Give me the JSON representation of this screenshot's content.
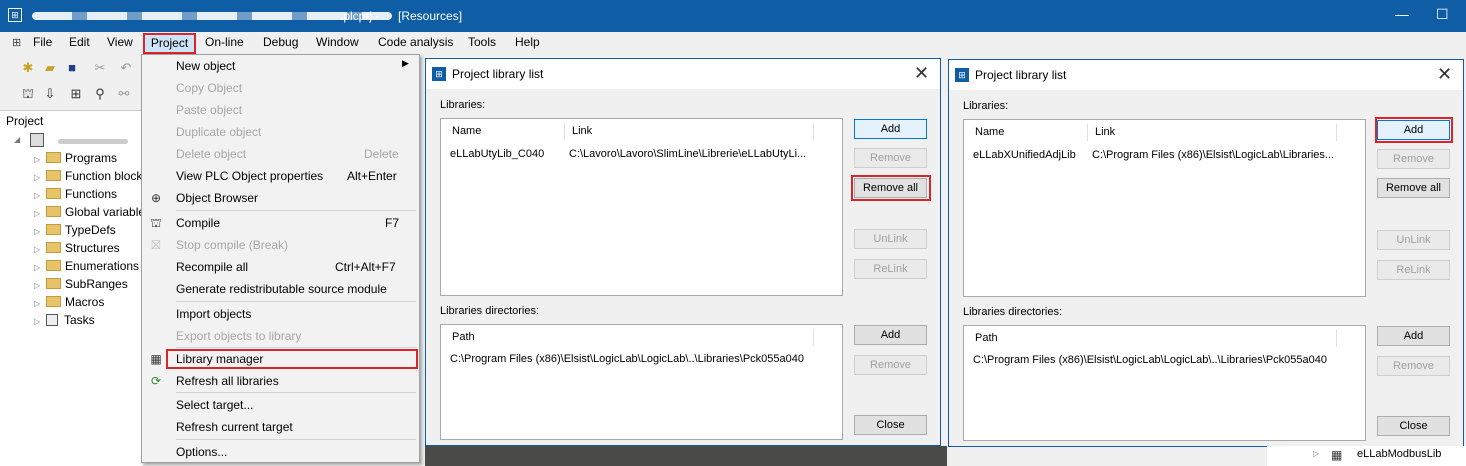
{
  "window": {
    "title": "[Resources]",
    "title_prefix_visible": ".plcprj - ",
    "app_icon": "logiclab-icon",
    "controls": [
      "—",
      "☐"
    ]
  },
  "menubar": {
    "items": [
      "File",
      "Edit",
      "View",
      "Project",
      "On-line",
      "Debug",
      "Window",
      "Code analysis",
      "Tools",
      "Help"
    ],
    "active": "Project"
  },
  "project_panel": {
    "header": "Project",
    "items": [
      "Programs",
      "Function blocks",
      "Functions",
      "Global variables",
      "TypeDefs",
      "Structures",
      "Enumerations",
      "SubRanges",
      "Macros",
      "Tasks"
    ]
  },
  "project_menu": {
    "items": [
      {
        "label": "New object",
        "shortcut": "",
        "disabled": false,
        "submenu": true
      },
      {
        "label": "Copy Object",
        "shortcut": "",
        "disabled": true
      },
      {
        "label": "Paste object",
        "shortcut": "",
        "disabled": true
      },
      {
        "label": "Duplicate object",
        "shortcut": "",
        "disabled": true
      },
      {
        "label": "Delete object",
        "shortcut": "Delete",
        "disabled": true
      },
      {
        "label": "View PLC Object properties",
        "shortcut": "Alt+Enter",
        "disabled": false
      },
      {
        "label": "Object Browser",
        "shortcut": "",
        "disabled": false
      },
      {
        "label": "Compile",
        "shortcut": "F7",
        "disabled": false
      },
      {
        "label": "Stop compile (Break)",
        "shortcut": "",
        "disabled": true
      },
      {
        "label": "Recompile all",
        "shortcut": "Ctrl+Alt+F7",
        "disabled": false
      },
      {
        "label": "Generate redistributable source module",
        "shortcut": "",
        "disabled": false
      },
      {
        "label": "Import objects",
        "shortcut": "",
        "disabled": false
      },
      {
        "label": "Export objects to library",
        "shortcut": "",
        "disabled": true
      },
      {
        "label": "Library manager",
        "shortcut": "",
        "disabled": false,
        "highlighted": true
      },
      {
        "label": "Refresh all libraries",
        "shortcut": "",
        "disabled": false
      },
      {
        "label": "Select target...",
        "shortcut": "",
        "disabled": false
      },
      {
        "label": "Refresh current target",
        "shortcut": "",
        "disabled": false
      },
      {
        "label": "Options...",
        "shortcut": "",
        "disabled": false
      }
    ]
  },
  "dialog_left": {
    "title": "Project library list",
    "libraries_label": "Libraries:",
    "col_name": "Name",
    "col_link": "Link",
    "row_name": "eLLabUtyLib_C040",
    "row_link": "C:\\Lavoro\\Lavoro\\SlimLine\\Librerie\\eLLabUtyLi...",
    "btn_add": "Add",
    "btn_remove": "Remove",
    "btn_remove_all": "Remove all",
    "btn_unlink": "UnLink",
    "btn_relink": "ReLink",
    "dirs_label": "Libraries directories:",
    "col_path": "Path",
    "dir_row": "C:\\Program Files (x86)\\Elsist\\LogicLab\\LogicLab\\..\\Libraries\\Pck055a040",
    "btn_add2": "Add",
    "btn_remove2": "Remove",
    "btn_close": "Close"
  },
  "dialog_right": {
    "title": "Project library list",
    "libraries_label": "Libraries:",
    "col_name": "Name",
    "col_link": "Link",
    "row_name": "eLLabXUnifiedAdjLib",
    "row_link": "C:\\Program Files (x86)\\Elsist\\LogicLab\\Libraries...",
    "btn_add": "Add",
    "btn_remove": "Remove",
    "btn_remove_all": "Remove all",
    "btn_unlink": "UnLink",
    "btn_relink": "ReLink",
    "dirs_label": "Libraries directories:",
    "col_path": "Path",
    "dir_row": "C:\\Program Files (x86)\\Elsist\\LogicLab\\LogicLab\\..\\Libraries\\Pck055a040",
    "btn_add2": "Add",
    "btn_remove2": "Remove",
    "btn_close": "Close"
  },
  "background": {
    "library_item": "eLLabModbusLib"
  },
  "colors": {
    "titlebar": "#0f5ea5",
    "highlight_red": "#d9262b",
    "primary_button_border": "#0078d7"
  }
}
